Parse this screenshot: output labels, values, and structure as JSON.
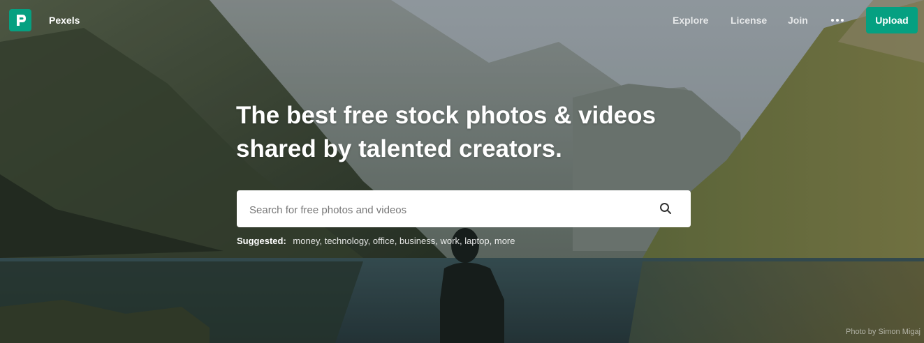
{
  "header": {
    "brand": "Pexels",
    "nav": {
      "explore": "Explore",
      "license": "License",
      "join": "Join"
    },
    "upload_label": "Upload"
  },
  "hero": {
    "headline_line1": "The best free stock photos & videos",
    "headline_line2": "shared by talented creators.",
    "search": {
      "placeholder": "Search for free photos and videos",
      "value": ""
    },
    "suggested_label": "Suggested:",
    "suggested": [
      "money,",
      "technology,",
      "office,",
      "business,",
      "work,",
      "laptop,",
      "more"
    ],
    "credit": "Photo by Simon Migaj"
  },
  "icons": {
    "logo": "pexels-logo-icon",
    "more": "more-dots-icon",
    "search": "search-icon"
  },
  "colors": {
    "accent": "#05a081",
    "text_on_image": "#ffffff"
  }
}
